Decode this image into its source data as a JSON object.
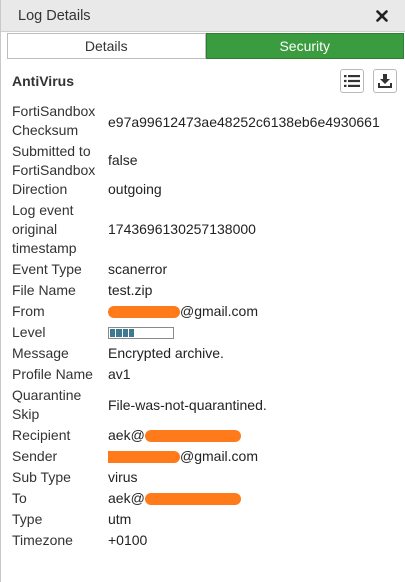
{
  "window": {
    "title": "Log Details"
  },
  "tabs": [
    {
      "label": "Details",
      "active": false
    },
    {
      "label": "Security",
      "active": true
    }
  ],
  "section": {
    "title": "AntiVirus"
  },
  "colors": {
    "active_tab": "#3b9b3f",
    "redaction": "#ff7a1a",
    "level_fill": "#3f7891"
  },
  "fields": {
    "checksum": {
      "label": "FortiSandbox Checksum",
      "value": "e97a99612473ae48252c6138eb6e4930661"
    },
    "submitted": {
      "label": "Submitted to FortiSandbox",
      "value": "false"
    },
    "direction": {
      "label": "Direction",
      "value": "outgoing"
    },
    "timestamp": {
      "label": "Log event original timestamp",
      "value": "1743696130257138000"
    },
    "event_type": {
      "label": "Event Type",
      "value": "scanerror"
    },
    "file_name": {
      "label": "File Name",
      "value": "test.zip"
    },
    "from": {
      "label": "From",
      "value_suffix": "@gmail.com"
    },
    "level": {
      "label": "Level",
      "segments_total": 10,
      "segments_filled": 4
    },
    "message": {
      "label": "Message",
      "value": "Encrypted archive."
    },
    "profile": {
      "label": "Profile Name",
      "value": "av1"
    },
    "quarantine": {
      "label": "Quarantine Skip",
      "value": "File-was-not-quarantined."
    },
    "recipient": {
      "label": "Recipient",
      "value_prefix": "aek@"
    },
    "sender": {
      "label": "Sender",
      "value_suffix": "@gmail.com"
    },
    "sub_type": {
      "label": "Sub Type",
      "value": "virus"
    },
    "to": {
      "label": "To",
      "value_prefix": "aek@"
    },
    "type": {
      "label": "Type",
      "value": "utm"
    },
    "timezone": {
      "label": "Timezone",
      "value": "+0100"
    }
  }
}
